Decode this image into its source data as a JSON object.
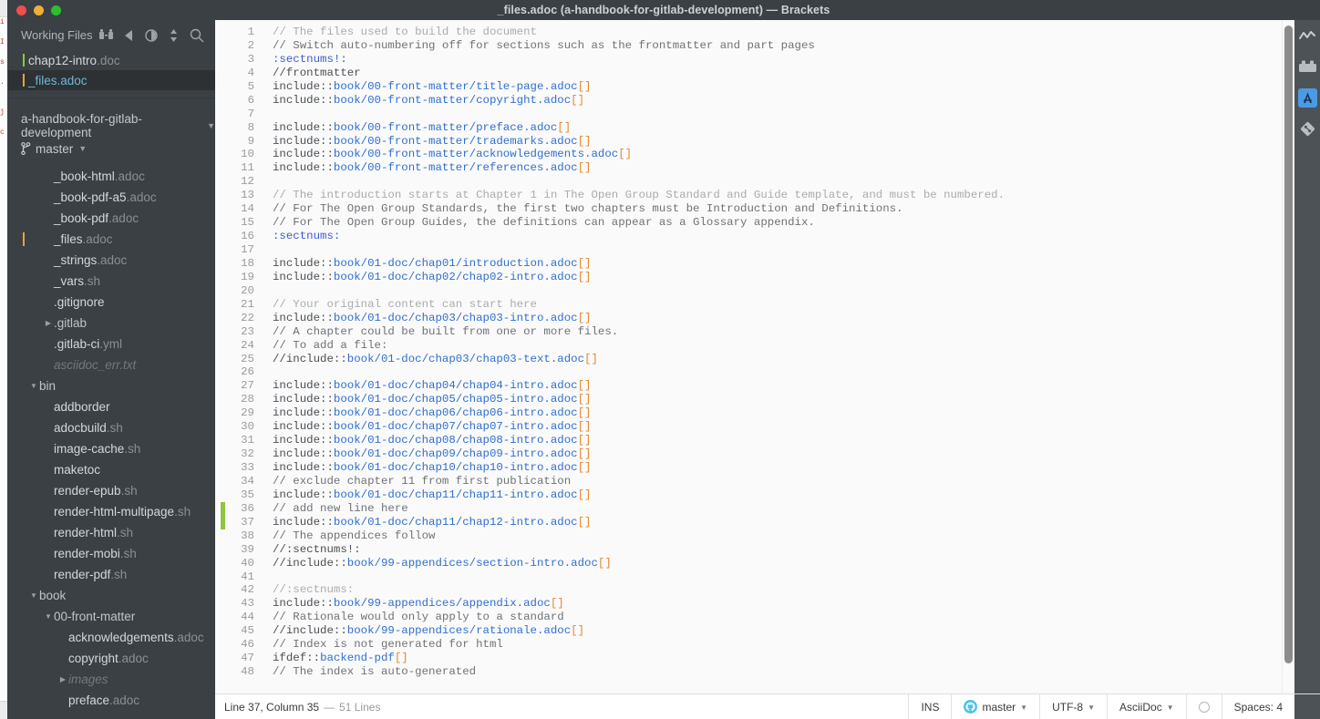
{
  "window": {
    "title": "_files.adoc (a-handbook-for-gitlab-development) — Brackets",
    "traffic_lights": [
      "close",
      "minimize",
      "zoom"
    ]
  },
  "sidebar": {
    "working_files": {
      "title": "Working Files",
      "toolbar_icons": [
        "split-view-icon",
        "collapse-left-icon",
        "contrast-icon",
        "sort-icon",
        "search-icon"
      ],
      "items": [
        {
          "name": "chap12-intro",
          "ext": ".doc",
          "bar": "green",
          "selected": false
        },
        {
          "name": "_files",
          "ext": ".adoc",
          "bar": "orange",
          "selected": true
        }
      ]
    },
    "project": {
      "name": "a-handbook-for-gitlab-development",
      "branch": "master",
      "tree": [
        {
          "label": "_book-html",
          "ext": ".adoc",
          "indent": 1,
          "type": "file"
        },
        {
          "label": "_book-pdf-a5",
          "ext": ".adoc",
          "indent": 1,
          "type": "file"
        },
        {
          "label": "_book-pdf",
          "ext": ".adoc",
          "indent": 1,
          "type": "file"
        },
        {
          "label": "_files",
          "ext": ".adoc",
          "indent": 1,
          "type": "file",
          "modified": true
        },
        {
          "label": "_strings",
          "ext": ".adoc",
          "indent": 1,
          "type": "file"
        },
        {
          "label": "_vars",
          "ext": ".sh",
          "indent": 1,
          "type": "file"
        },
        {
          "label": ".gitignore",
          "ext": "",
          "indent": 1,
          "type": "file"
        },
        {
          "label": ".gitlab",
          "ext": "",
          "indent": 1,
          "type": "folder",
          "open": false
        },
        {
          "label": ".gitlab-ci",
          "ext": ".yml",
          "indent": 1,
          "type": "file"
        },
        {
          "label": "asciidoc_err.txt",
          "ext": "",
          "indent": 1,
          "type": "file",
          "dim": true
        },
        {
          "label": "bin",
          "ext": "",
          "indent": 0,
          "type": "folder",
          "open": true
        },
        {
          "label": "addborder",
          "ext": "",
          "indent": 1,
          "type": "file"
        },
        {
          "label": "adocbuild",
          "ext": ".sh",
          "indent": 1,
          "type": "file"
        },
        {
          "label": "image-cache",
          "ext": ".sh",
          "indent": 1,
          "type": "file"
        },
        {
          "label": "maketoc",
          "ext": "",
          "indent": 1,
          "type": "file"
        },
        {
          "label": "render-epub",
          "ext": ".sh",
          "indent": 1,
          "type": "file"
        },
        {
          "label": "render-html-multipage",
          "ext": ".sh",
          "indent": 1,
          "type": "file"
        },
        {
          "label": "render-html",
          "ext": ".sh",
          "indent": 1,
          "type": "file"
        },
        {
          "label": "render-mobi",
          "ext": ".sh",
          "indent": 1,
          "type": "file"
        },
        {
          "label": "render-pdf",
          "ext": ".sh",
          "indent": 1,
          "type": "file"
        },
        {
          "label": "book",
          "ext": "",
          "indent": 0,
          "type": "folder",
          "open": true
        },
        {
          "label": "00-front-matter",
          "ext": "",
          "indent": 1,
          "type": "folder",
          "open": true
        },
        {
          "label": "acknowledgements",
          "ext": ".adoc",
          "indent": 2,
          "type": "file"
        },
        {
          "label": "copyright",
          "ext": ".adoc",
          "indent": 2,
          "type": "file"
        },
        {
          "label": "images",
          "ext": "",
          "indent": 2,
          "type": "folder",
          "open": false,
          "dim": true
        },
        {
          "label": "preface",
          "ext": ".adoc",
          "indent": 2,
          "type": "file"
        }
      ]
    }
  },
  "editor": {
    "first_line": 1,
    "change_marker_lines": [
      36,
      37
    ],
    "lines": [
      {
        "n": 1,
        "tokens": [
          {
            "t": "comment-light",
            "s": "// The files used to build the document"
          }
        ]
      },
      {
        "n": 2,
        "tokens": [
          {
            "t": "comment",
            "s": "// Switch auto-numbering off for sections such as the frontmatter and part pages"
          }
        ]
      },
      {
        "n": 3,
        "tokens": [
          {
            "t": "attr",
            "s": ":sectnums!:"
          }
        ]
      },
      {
        "n": 4,
        "tokens": [
          {
            "t": "plain",
            "s": "//frontmatter"
          }
        ]
      },
      {
        "n": 5,
        "tokens": [
          {
            "t": "plain",
            "s": "include::"
          },
          {
            "t": "path",
            "s": "book/00-front-matter/title-page.adoc"
          },
          {
            "t": "brk",
            "s": "[]"
          }
        ]
      },
      {
        "n": 6,
        "tokens": [
          {
            "t": "plain",
            "s": "include::"
          },
          {
            "t": "path",
            "s": "book/00-front-matter/copyright.adoc"
          },
          {
            "t": "brk",
            "s": "[]"
          }
        ]
      },
      {
        "n": 7,
        "tokens": []
      },
      {
        "n": 8,
        "tokens": [
          {
            "t": "plain",
            "s": "include::"
          },
          {
            "t": "path",
            "s": "book/00-front-matter/preface.adoc"
          },
          {
            "t": "brk",
            "s": "[]"
          }
        ]
      },
      {
        "n": 9,
        "tokens": [
          {
            "t": "plain",
            "s": "include::"
          },
          {
            "t": "path",
            "s": "book/00-front-matter/trademarks.adoc"
          },
          {
            "t": "brk",
            "s": "[]"
          }
        ]
      },
      {
        "n": 10,
        "tokens": [
          {
            "t": "plain",
            "s": "include::"
          },
          {
            "t": "path",
            "s": "book/00-front-matter/acknowledgements.adoc"
          },
          {
            "t": "brk",
            "s": "[]"
          }
        ]
      },
      {
        "n": 11,
        "tokens": [
          {
            "t": "plain",
            "s": "include::"
          },
          {
            "t": "path",
            "s": "book/00-front-matter/references.adoc"
          },
          {
            "t": "brk",
            "s": "[]"
          }
        ]
      },
      {
        "n": 12,
        "tokens": []
      },
      {
        "n": 13,
        "tokens": [
          {
            "t": "comment-light",
            "s": "// The introduction starts at Chapter 1 in The Open Group Standard and Guide template, and must be numbered."
          }
        ]
      },
      {
        "n": 14,
        "tokens": [
          {
            "t": "comment",
            "s": "// For The Open Group Standards, the first two chapters must be Introduction and Definitions."
          }
        ]
      },
      {
        "n": 15,
        "tokens": [
          {
            "t": "comment",
            "s": "// For The Open Group Guides, the definitions can appear as a Glossary appendix."
          }
        ]
      },
      {
        "n": 16,
        "tokens": [
          {
            "t": "attr",
            "s": ":sectnums:"
          }
        ]
      },
      {
        "n": 17,
        "tokens": []
      },
      {
        "n": 18,
        "tokens": [
          {
            "t": "plain",
            "s": "include::"
          },
          {
            "t": "path",
            "s": "book/01-doc/chap01/introduction.adoc"
          },
          {
            "t": "brk",
            "s": "[]"
          }
        ]
      },
      {
        "n": 19,
        "tokens": [
          {
            "t": "plain",
            "s": "include::"
          },
          {
            "t": "path",
            "s": "book/01-doc/chap02/chap02-intro.adoc"
          },
          {
            "t": "brk",
            "s": "[]"
          }
        ]
      },
      {
        "n": 20,
        "tokens": []
      },
      {
        "n": 21,
        "tokens": [
          {
            "t": "comment-light",
            "s": "// Your original content can start here"
          }
        ]
      },
      {
        "n": 22,
        "tokens": [
          {
            "t": "plain",
            "s": "include::"
          },
          {
            "t": "path",
            "s": "book/01-doc/chap03/chap03-intro.adoc"
          },
          {
            "t": "brk",
            "s": "[]"
          }
        ]
      },
      {
        "n": 23,
        "tokens": [
          {
            "t": "comment",
            "s": "// A chapter could be built from one or more files."
          }
        ]
      },
      {
        "n": 24,
        "tokens": [
          {
            "t": "comment",
            "s": "// To add a file:"
          }
        ]
      },
      {
        "n": 25,
        "tokens": [
          {
            "t": "plain",
            "s": "//include::"
          },
          {
            "t": "path",
            "s": "book/01-doc/chap03/chap03-text.adoc"
          },
          {
            "t": "brk",
            "s": "[]"
          }
        ]
      },
      {
        "n": 26,
        "tokens": []
      },
      {
        "n": 27,
        "tokens": [
          {
            "t": "plain",
            "s": "include::"
          },
          {
            "t": "path",
            "s": "book/01-doc/chap04/chap04-intro.adoc"
          },
          {
            "t": "brk",
            "s": "[]"
          }
        ]
      },
      {
        "n": 28,
        "tokens": [
          {
            "t": "plain",
            "s": "include::"
          },
          {
            "t": "path",
            "s": "book/01-doc/chap05/chap05-intro.adoc"
          },
          {
            "t": "brk",
            "s": "[]"
          }
        ]
      },
      {
        "n": 29,
        "tokens": [
          {
            "t": "plain",
            "s": "include::"
          },
          {
            "t": "path",
            "s": "book/01-doc/chap06/chap06-intro.adoc"
          },
          {
            "t": "brk",
            "s": "[]"
          }
        ]
      },
      {
        "n": 30,
        "tokens": [
          {
            "t": "plain",
            "s": "include::"
          },
          {
            "t": "path",
            "s": "book/01-doc/chap07/chap07-intro.adoc"
          },
          {
            "t": "brk",
            "s": "[]"
          }
        ]
      },
      {
        "n": 31,
        "tokens": [
          {
            "t": "plain",
            "s": "include::"
          },
          {
            "t": "path",
            "s": "book/01-doc/chap08/chap08-intro.adoc"
          },
          {
            "t": "brk",
            "s": "[]"
          }
        ]
      },
      {
        "n": 32,
        "tokens": [
          {
            "t": "plain",
            "s": "include::"
          },
          {
            "t": "path",
            "s": "book/01-doc/chap09/chap09-intro.adoc"
          },
          {
            "t": "brk",
            "s": "[]"
          }
        ]
      },
      {
        "n": 33,
        "tokens": [
          {
            "t": "plain",
            "s": "include::"
          },
          {
            "t": "path",
            "s": "book/01-doc/chap10/chap10-intro.adoc"
          },
          {
            "t": "brk",
            "s": "[]"
          }
        ]
      },
      {
        "n": 34,
        "tokens": [
          {
            "t": "comment",
            "s": "// exclude chapter 11 from first publication"
          }
        ]
      },
      {
        "n": 35,
        "tokens": [
          {
            "t": "plain",
            "s": "include::"
          },
          {
            "t": "path",
            "s": "book/01-doc/chap11/chap11-intro.adoc"
          },
          {
            "t": "brk",
            "s": "[]"
          }
        ]
      },
      {
        "n": 36,
        "tokens": [
          {
            "t": "comment",
            "s": "// add new line here"
          }
        ]
      },
      {
        "n": 37,
        "tokens": [
          {
            "t": "plain",
            "s": "include::"
          },
          {
            "t": "path",
            "s": "book/01-doc/chap11/chap12-intro.adoc"
          },
          {
            "t": "brk",
            "s": "[]"
          }
        ]
      },
      {
        "n": 38,
        "tokens": [
          {
            "t": "comment",
            "s": "// The appendices follow"
          }
        ]
      },
      {
        "n": 39,
        "tokens": [
          {
            "t": "plain",
            "s": "//:sectnums!:"
          }
        ]
      },
      {
        "n": 40,
        "tokens": [
          {
            "t": "plain",
            "s": "//include::"
          },
          {
            "t": "path",
            "s": "book/99-appendices/section-intro.adoc"
          },
          {
            "t": "brk",
            "s": "[]"
          }
        ]
      },
      {
        "n": 41,
        "tokens": []
      },
      {
        "n": 42,
        "tokens": [
          {
            "t": "comment-light",
            "s": "//:sectnums:"
          }
        ]
      },
      {
        "n": 43,
        "tokens": [
          {
            "t": "plain",
            "s": "include::"
          },
          {
            "t": "path",
            "s": "book/99-appendices/appendix.adoc"
          },
          {
            "t": "brk",
            "s": "[]"
          }
        ]
      },
      {
        "n": 44,
        "tokens": [
          {
            "t": "comment",
            "s": "// Rationale would only apply to a standard"
          }
        ]
      },
      {
        "n": 45,
        "tokens": [
          {
            "t": "plain",
            "s": "//include::"
          },
          {
            "t": "path",
            "s": "book/99-appendices/rationale.adoc"
          },
          {
            "t": "brk",
            "s": "[]"
          }
        ]
      },
      {
        "n": 46,
        "tokens": [
          {
            "t": "comment",
            "s": "// Index is not generated for html"
          }
        ]
      },
      {
        "n": 47,
        "tokens": [
          {
            "t": "plain",
            "s": "ifdef::"
          },
          {
            "t": "path",
            "s": "backend-pdf"
          },
          {
            "t": "brk",
            "s": "[]"
          }
        ]
      },
      {
        "n": 48,
        "tokens": [
          {
            "t": "comment",
            "s": "// The index is auto-generated"
          }
        ]
      }
    ]
  },
  "right_toolbar": {
    "items": [
      {
        "icon": "live-preview-icon",
        "active": false
      },
      {
        "icon": "extension-manager-icon",
        "active": false
      },
      {
        "icon": "asciidoc-preview-icon",
        "active": true
      },
      {
        "icon": "git-icon",
        "active": false
      }
    ]
  },
  "statusbar": {
    "cursor": "Line 37, Column 35",
    "dash": "—",
    "line_count": "51 Lines",
    "insert_mode": "INS",
    "branch": "master",
    "encoding": "UTF-8",
    "language": "AsciiDoc",
    "lint_status": "lint-ok-icon",
    "indent": "Spaces: 4"
  },
  "colors": {
    "accent_blue": "#2f6fd0",
    "bracket_orange": "#e8862b",
    "attribute_blue": "#3c5ccc",
    "change_green": "#8cc63e",
    "modified_orange": "#e8a33d",
    "sidebar_bg": "#3b4045",
    "editor_bg": "#fafafa",
    "toolbar_bg": "#4c5256",
    "active_badge": "#4b9ae3"
  }
}
